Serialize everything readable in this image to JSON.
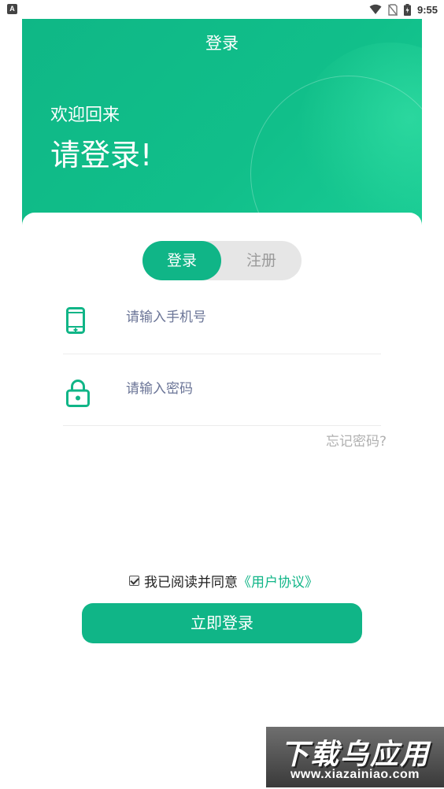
{
  "status_bar": {
    "left_icon": "A",
    "time": "9:55",
    "icons": [
      "wifi-icon",
      "no-sim-icon",
      "battery-charging-icon"
    ]
  },
  "header": {
    "title": "登录",
    "welcome": "欢迎回来",
    "prompt": "请登录!"
  },
  "tabs": {
    "login": "登录",
    "register": "注册",
    "active": "login"
  },
  "form": {
    "phone_placeholder": "请输入手机号",
    "phone_icon": "phone-icon",
    "password_placeholder": "请输入密码",
    "password_icon": "lock-icon",
    "forgot": "忘记密码?"
  },
  "agreement": {
    "checked": true,
    "text": "我已阅读并同意",
    "link": "《用户协议》"
  },
  "submit_label": "立即登录",
  "watermark": {
    "title": "下载乌应用",
    "url": "www.xiazainiao.com"
  },
  "colors": {
    "accent": "#10b587",
    "placeholder": "#6b7597",
    "muted": "#9a9a9a"
  }
}
